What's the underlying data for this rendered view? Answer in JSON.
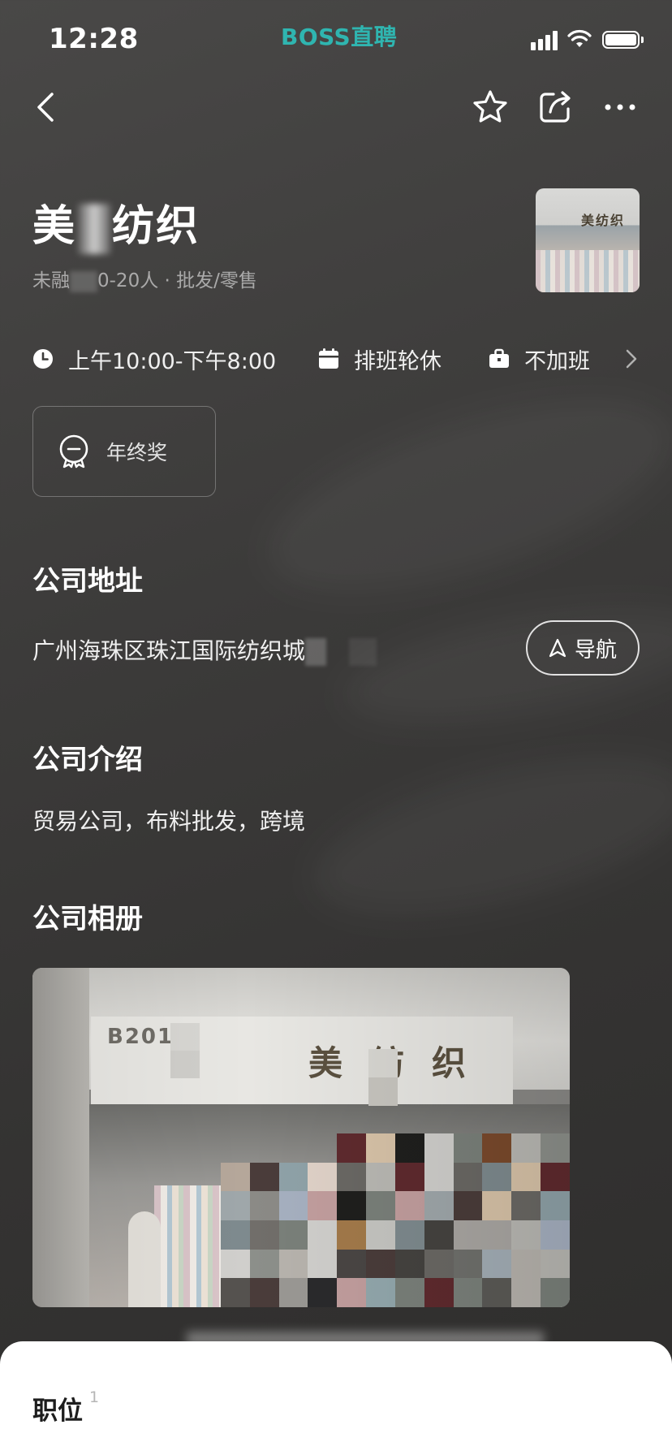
{
  "status_bar": {
    "time": "12:28",
    "brand": "BOSS直聘"
  },
  "nav": {
    "back_icon": "chevron-left-icon",
    "favorite_icon": "star-outline-icon",
    "share_icon": "share-icon",
    "more_icon": "more-dots-icon"
  },
  "company": {
    "name_part1": "美",
    "name_part2": "纺织",
    "meta_part1": "未融",
    "meta_part2": "0-20人 · 批发/零售"
  },
  "welfare": {
    "hours": "上午10:00-下午8:00",
    "schedule": "排班轮休",
    "overtime": "不加班"
  },
  "bonus": {
    "label": "年终奖"
  },
  "address": {
    "title": "公司地址",
    "text": "广州海珠区珠江国际纺织城",
    "nav_button": "导航"
  },
  "intro": {
    "title": "公司介绍",
    "text": "贸易公司，布料批发，跨境"
  },
  "album": {
    "title": "公司相册",
    "sign_code": "B201",
    "sign_text": "美纺织"
  },
  "sheet": {
    "title": "职位",
    "count": "1"
  },
  "colors": {
    "brand_teal": "#2fb5b0",
    "background": "#3c3b3a",
    "sheet": "#ffffff"
  }
}
